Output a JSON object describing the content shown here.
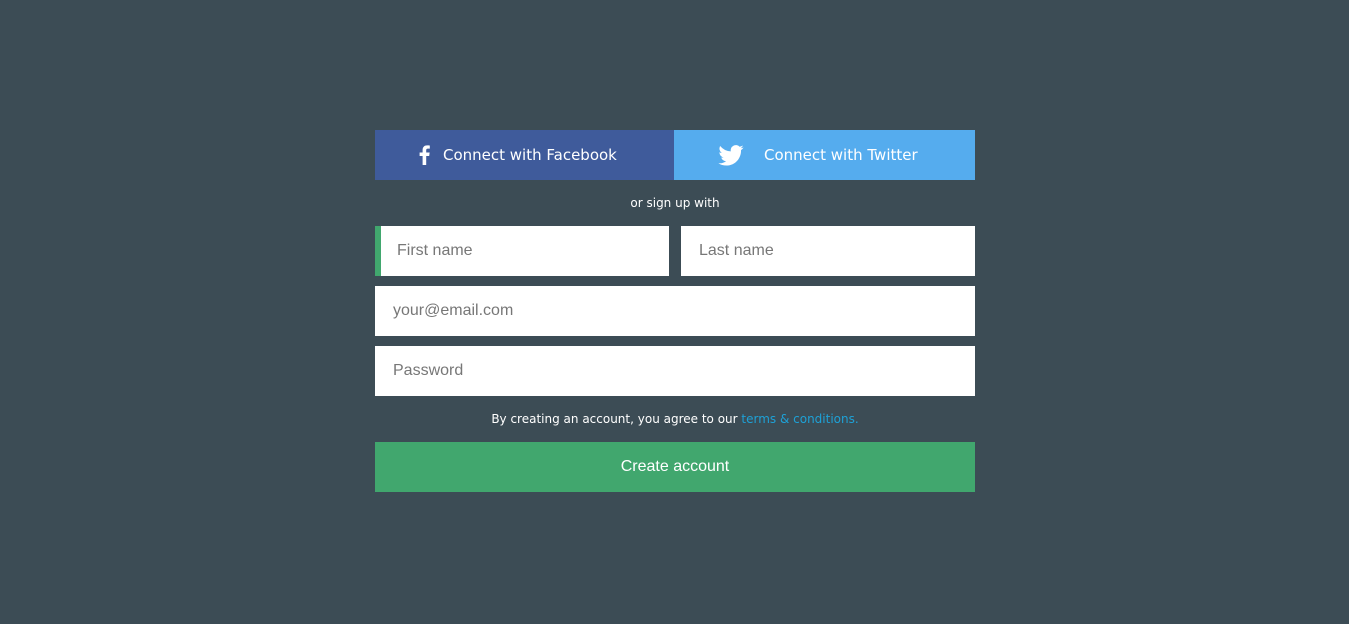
{
  "colors": {
    "background": "#3c4c55",
    "facebook": "#3f5b9b",
    "twitter": "#55acee",
    "accent_green": "#41a76e",
    "link": "#1ea1d6"
  },
  "social": {
    "facebook": {
      "label": "Connect with Facebook",
      "icon": "facebook-icon"
    },
    "twitter": {
      "label": "Connect with Twitter",
      "icon": "twitter-icon"
    }
  },
  "divider_text": "or sign up with",
  "form": {
    "first_name": {
      "placeholder": "First name",
      "value": ""
    },
    "last_name": {
      "placeholder": "Last name",
      "value": ""
    },
    "email": {
      "placeholder": "your@email.com",
      "value": ""
    },
    "password": {
      "placeholder": "Password",
      "value": ""
    }
  },
  "terms": {
    "text": "By creating an account, you agree to our ",
    "link_label": "terms & conditions."
  },
  "submit_label": "Create account"
}
